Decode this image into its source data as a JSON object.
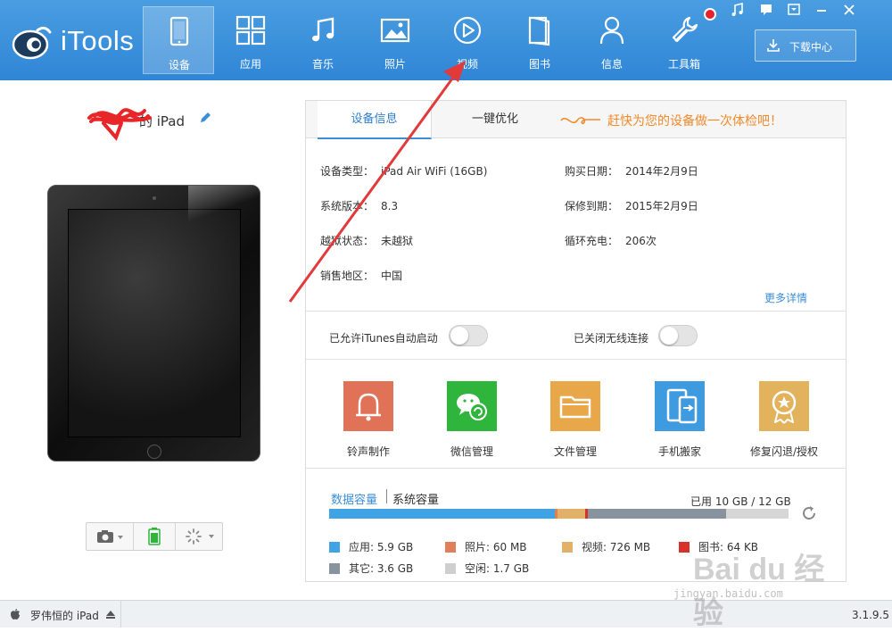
{
  "app": {
    "name": "iTools",
    "colors": {
      "header": "#3b8fd8",
      "accent": "#3b8fd8",
      "notify": "#e8212f",
      "promo": "#f08a2c"
    }
  },
  "nav": {
    "items": [
      {
        "label": "设备",
        "icon": "device-icon",
        "active": true
      },
      {
        "label": "应用",
        "icon": "apps-grid-icon"
      },
      {
        "label": "音乐",
        "icon": "music-note-icon"
      },
      {
        "label": "照片",
        "icon": "photo-icon"
      },
      {
        "label": "视频",
        "icon": "video-play-icon"
      },
      {
        "label": "图书",
        "icon": "book-icon"
      },
      {
        "label": "信息",
        "icon": "user-icon"
      },
      {
        "label": "工具箱",
        "icon": "wrench-icon"
      }
    ],
    "download_label": "下载中心"
  },
  "device": {
    "name_suffix": "的 iPad"
  },
  "tabs": {
    "info": "设备信息",
    "optimize": "一键优化",
    "promo": "赶快为您的设备做一次体检吧！"
  },
  "info": {
    "type_label": "设备类型：",
    "type_value": "iPad Air WiFi   (16GB)",
    "os_label": "系统版本：",
    "os_value": "8.3",
    "jb_label": "越狱状态：",
    "jb_value": "未越狱",
    "region_label": "销售地区：",
    "region_value": "中国",
    "purchase_label": "购买日期：",
    "purchase_value": "2014年2月9日",
    "warranty_label": "保修到期：",
    "warranty_value": "2015年2月9日",
    "cycles_label": "循环充电：",
    "cycles_value": "206次",
    "more": "更多详情"
  },
  "toggles": {
    "itunes": "已允许iTunes自动启动",
    "wifi": "已关闭无线连接"
  },
  "tools": [
    {
      "label": "铃声制作",
      "icon": "bell-icon",
      "color": "#e07257"
    },
    {
      "label": "微信管理",
      "icon": "wechat-icon",
      "color": "#2fb53b"
    },
    {
      "label": "文件管理",
      "icon": "folder-icon",
      "color": "#e8a84a"
    },
    {
      "label": "手机搬家",
      "icon": "phone-transfer-icon",
      "color": "#3f9be0"
    },
    {
      "label": "修复闪退/授权",
      "icon": "badge-star-icon",
      "color": "#e3b25c"
    }
  ],
  "storage": {
    "tab_data": "数据容量",
    "tab_system": "系统容量",
    "used_text": "已用 10 GB / 12 GB",
    "segments": [
      {
        "name": "应用",
        "gb": 5.9,
        "color": "#3fa3e6"
      },
      {
        "name": "照片",
        "gb": 0.06,
        "color": "#e0805a"
      },
      {
        "name": "视频",
        "gb": 0.726,
        "color": "#e2b066"
      },
      {
        "name": "图书",
        "gb": 0.064,
        "color": "#d8312c"
      },
      {
        "name": "其它",
        "gb": 3.6,
        "color": "#8794a0"
      }
    ],
    "total_gb": 12,
    "legend": [
      {
        "text": "应用: 5.9 GB",
        "color": "#3fa3e6"
      },
      {
        "text": "照片: 60 MB",
        "color": "#e0805a"
      },
      {
        "text": "视频: 726 MB",
        "color": "#e2b066"
      },
      {
        "text": "图书: 64 KB",
        "color": "#d8312c"
      },
      {
        "text": "其它: 3.6 GB",
        "color": "#8794a0"
      },
      {
        "text": "空闲: 1.7 GB",
        "color": "#cfcfcf"
      }
    ]
  },
  "statusbar": {
    "device": "罗伟恒的 iPad",
    "version": "3.1.9.5"
  },
  "watermark": {
    "text": "Bai du 经验",
    "url": "jingyan.baidu.com"
  }
}
